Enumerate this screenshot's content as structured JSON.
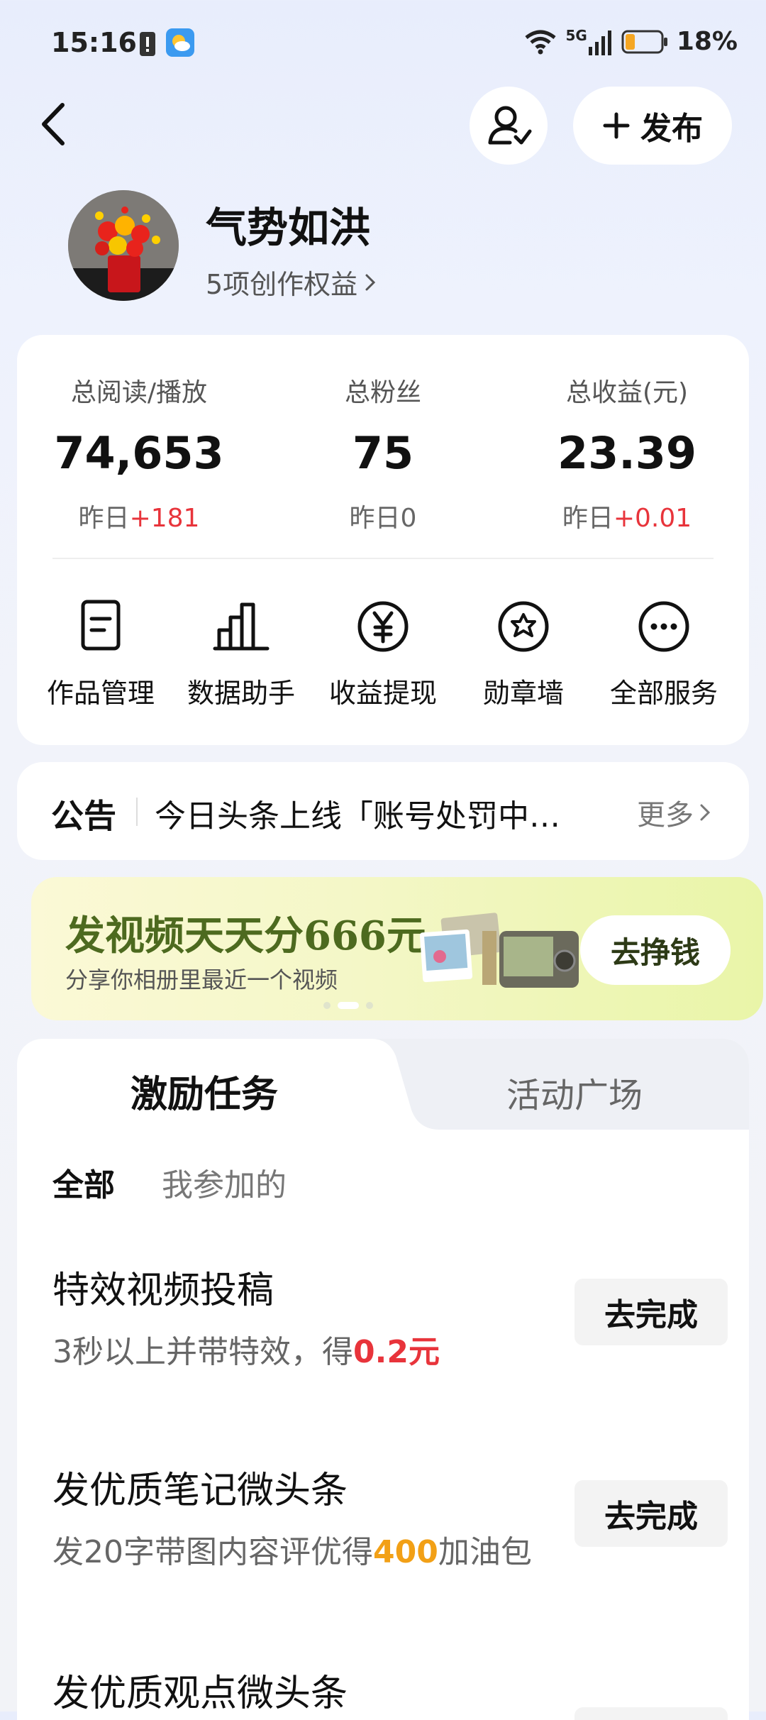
{
  "status_bar": {
    "time": "15:16",
    "network": "5G",
    "battery": "18%"
  },
  "header": {
    "publish_label": "发布"
  },
  "profile": {
    "name": "气势如洪",
    "benefits": "5项创作权益"
  },
  "stats": [
    {
      "label": "总阅读/播放",
      "value": "74,653",
      "delta_prefix": "昨日",
      "delta": "+181",
      "delta_color": "#e8343b"
    },
    {
      "label": "总粉丝",
      "value": "75",
      "delta_prefix": "昨日",
      "delta": "0",
      "delta_color": "#666666"
    },
    {
      "label": "总收益(元)",
      "value": "23.39",
      "delta_prefix": "昨日",
      "delta": "+0.01",
      "delta_color": "#e8343b"
    }
  ],
  "services": [
    {
      "label": "作品管理",
      "icon": "document-icon"
    },
    {
      "label": "数据助手",
      "icon": "bar-chart-icon"
    },
    {
      "label": "收益提现",
      "icon": "yen-icon"
    },
    {
      "label": "勋章墙",
      "icon": "badge-icon"
    },
    {
      "label": "全部服务",
      "icon": "more-icon"
    }
  ],
  "notice": {
    "label": "公告",
    "text": "今日头条上线「账号处罚中…",
    "more": "更多"
  },
  "banner": {
    "title": "发视频天天分666元",
    "subtitle": "分享你相册里最近一个视频",
    "button": "去挣钱"
  },
  "tasks": {
    "tabs": [
      "激励任务",
      "活动广场"
    ],
    "filters": [
      "全部",
      "我参加的"
    ],
    "items": [
      {
        "title": "特效视频投稿",
        "desc_pre": "3秒以上并带特效，得",
        "desc_highlight": "0.2元",
        "desc_post": "",
        "button": "去完成"
      },
      {
        "title": "发优质笔记微头条",
        "desc_pre": "发20字带图内容评优得",
        "desc_highlight": "400",
        "desc_post": "加油包",
        "button": "去完成"
      },
      {
        "title": "发优质观点微头条"
      }
    ]
  },
  "colors": {
    "accent_red": "#e8343b",
    "accent_orange": "#f2a016",
    "banner_green": "#4d6a1f"
  }
}
